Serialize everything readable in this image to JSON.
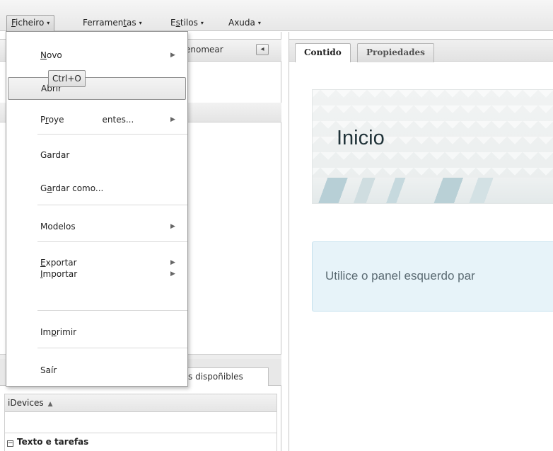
{
  "menubar": {
    "items": [
      {
        "pre": "",
        "u": "F",
        "post": "icheiro",
        "caret": "▾"
      },
      {
        "pre": "Ferramen",
        "u": "t",
        "post": "as",
        "caret": "▾"
      },
      {
        "pre": "E",
        "u": "s",
        "post": "tilos",
        "caret": "▾"
      },
      {
        "pre": "Axuda",
        "u": "",
        "post": "",
        "caret": "▾"
      }
    ]
  },
  "left_panel": {
    "rename_label": "enomear",
    "collapse_icon": "◂",
    "idevices_tab": "s dispoñibles",
    "idevices_header": "iDevices",
    "sort_icon": "▲",
    "category_box": "−",
    "category": "Texto e tarefas"
  },
  "right_panel": {
    "tabs": [
      "Contido",
      "Propiedades"
    ],
    "hero_title": "Inicio",
    "info_text": "Utilice o panel esquerdo par"
  },
  "dropdown": {
    "arrow_icon": "▶",
    "items": {
      "novo": {
        "u": "N",
        "post": "ovo"
      },
      "abrir": {
        "label": "Abrir"
      },
      "proyectos": {
        "pre": "P",
        "u": "r",
        "post": "oye",
        "tail": "entes..."
      },
      "gardar": {
        "label": "Gardar"
      },
      "gardar_como": {
        "pre": "G",
        "u": "a",
        "post": "rdar como..."
      },
      "modelos": {
        "label": "Modelos"
      },
      "exportar": {
        "u": "E",
        "post": "xportar"
      },
      "importar": {
        "u": "I",
        "post": "mportar"
      },
      "imprimir": {
        "pre": "Im",
        "u": "p",
        "post": "rimir"
      },
      "sair": {
        "label": "Saír"
      }
    },
    "tooltip": "Ctrl+O"
  }
}
